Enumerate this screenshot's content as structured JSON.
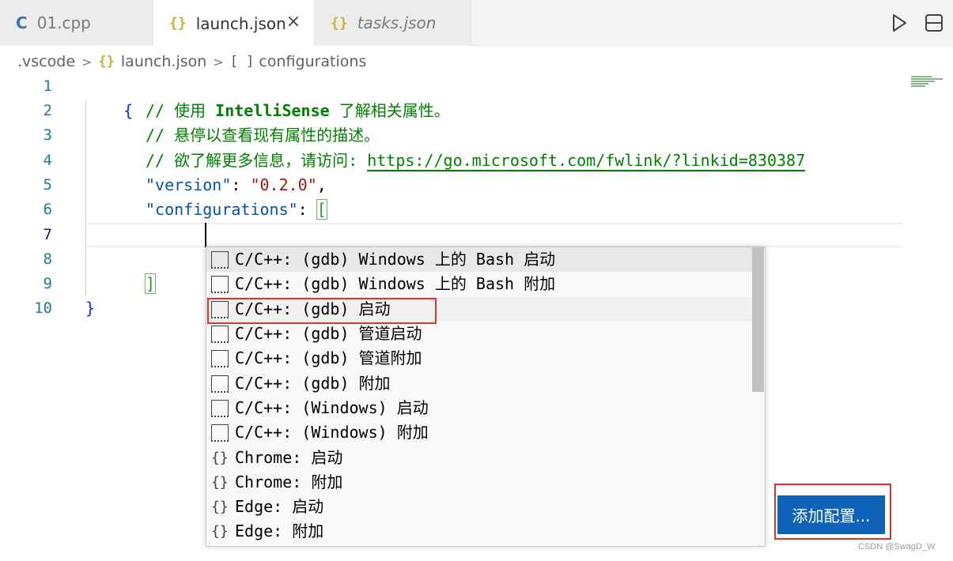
{
  "tabs": [
    {
      "icon": "C",
      "label": "01.cpp",
      "active": false,
      "italic": false
    },
    {
      "icon": "{}",
      "label": "launch.json",
      "active": true,
      "italic": false,
      "close": "×"
    },
    {
      "icon": "{}",
      "label": "tasks.json",
      "active": false,
      "italic": true
    }
  ],
  "breadcrumb": {
    "folder": ".vscode",
    "file_icon": "{}",
    "file": "launch.json",
    "symbol_icon": "[ ]",
    "symbol": "configurations"
  },
  "editor": {
    "line_numbers": [
      "1",
      "2",
      "3",
      "4",
      "5",
      "6",
      "7",
      "8",
      "9",
      "10"
    ],
    "line1": "{",
    "line2_prefix": "// 使用 ",
    "line2_bold": "IntelliSense",
    "line2_suffix": " 了解相关属性。",
    "line3": "// 悬停以查看现有属性的描述。",
    "line4_prefix": "// 欲了解更多信息，请访问: ",
    "line4_link": "https://go.microsoft.com/fwlink/?linkid=830387",
    "line5_key": "\"version\"",
    "line5_colon": ": ",
    "line5_value": "\"0.2.0\"",
    "line5_comma": ",",
    "line6_key": "\"configurations\"",
    "line6_colon": ": ",
    "line6_bracket": "[",
    "line9": "]",
    "line10": "}"
  },
  "suggestions": [
    {
      "kind": "snippet",
      "label": "C/C++: (gdb) Windows 上的 Bash 启动"
    },
    {
      "kind": "snippet",
      "label": "C/C++: (gdb) Windows 上的 Bash 附加"
    },
    {
      "kind": "snippet",
      "label": "C/C++: (gdb) 启动"
    },
    {
      "kind": "snippet",
      "label": "C/C++: (gdb) 管道启动"
    },
    {
      "kind": "snippet",
      "label": "C/C++: (gdb) 管道附加"
    },
    {
      "kind": "snippet",
      "label": "C/C++: (gdb) 附加"
    },
    {
      "kind": "snippet",
      "label": "C/C++: (Windows) 启动"
    },
    {
      "kind": "snippet",
      "label": "C/C++: (Windows) 附加"
    },
    {
      "kind": "object",
      "label": "Chrome: 启动"
    },
    {
      "kind": "object",
      "label": "Chrome: 附加"
    },
    {
      "kind": "object",
      "label": "Edge: 启动"
    },
    {
      "kind": "object",
      "label": "Edge: 附加"
    }
  ],
  "suggest_brace_icon": "{}",
  "add_config_button": "添加配置...",
  "watermark": "CSDN @SwagD_W",
  "colors": {
    "button": "#0e63b8",
    "highlight_box": "#e03030",
    "comment": "#008000",
    "json_key": "#0451a5",
    "json_string": "#a31515"
  }
}
